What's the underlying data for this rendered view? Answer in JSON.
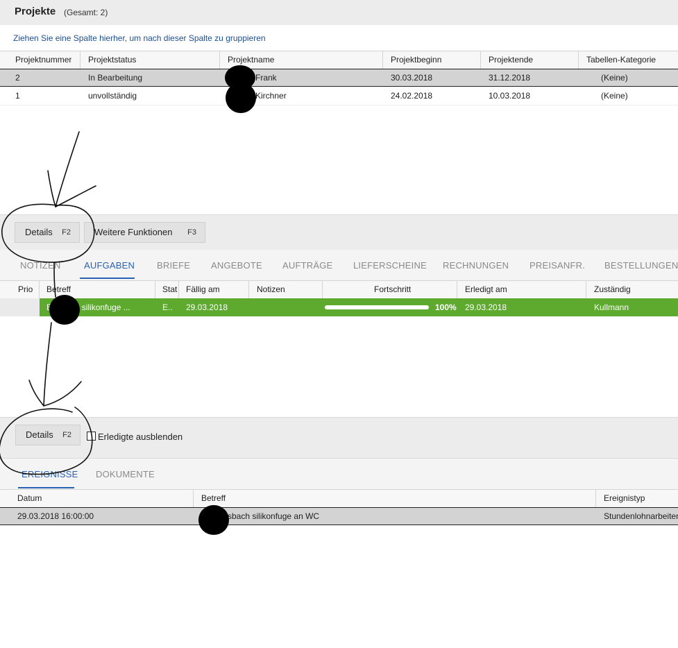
{
  "header": {
    "title": "Projekte",
    "total": "(Gesamt: 2)"
  },
  "group_hint": "Ziehen Sie eine Spalte hierher, um nach dieser Spalte zu gruppieren",
  "projects": {
    "columns": [
      "Projektnummer",
      "Projektstatus",
      "Projektname",
      "Projektbeginn",
      "Projektende",
      "Tabellen-Kategorie"
    ],
    "rows": [
      {
        "nummer": "2",
        "status": "In Bearbeitung",
        "name": "Frank",
        "beginn": "30.03.2018",
        "ende": "31.12.2018",
        "kategorie": "(Keine)"
      },
      {
        "nummer": "1",
        "status": "unvollständig",
        "name": "Kirchner",
        "beginn": "24.02.2018",
        "ende": "10.03.2018",
        "kategorie": "(Keine)"
      }
    ]
  },
  "toolbar1": {
    "details_label": "Details",
    "details_key": "F2",
    "more_label": "Weitere Funktionen",
    "more_key": "F3"
  },
  "tabs1": [
    "NOTIZEN",
    "AUFGABEN",
    "BRIEFE",
    "ANGEBOTE",
    "AUFTRÄGE",
    "LIEFERSCHEINE",
    "RECHNUNGEN",
    "PREISANFR.",
    "BESTELLUNGEN"
  ],
  "tasks": {
    "columns": [
      "Prio",
      "Betreff",
      "Stat",
      "Fällig am",
      "Notizen",
      "Fortschritt",
      "Erledigt am",
      "Zuständig"
    ],
    "rows": [
      {
        "prio": "",
        "betreff": "E... bach silikonfuge ...",
        "status": "E..",
        "faellig": "29.03.2018",
        "notizen": "",
        "progress": 1.0,
        "progress_label": "100%",
        "erledigt": "29.03.2018",
        "zustaendig": "Kullmann"
      }
    ]
  },
  "toolbar2": {
    "details_label": "Details",
    "details_key": "F2",
    "hide_done_label": "Erledigte ausblenden",
    "hide_done_checked": false
  },
  "tabs2": [
    "EREIGNISSE",
    "DOKUMENTE"
  ],
  "events": {
    "columns": [
      "Datum",
      "Betreff",
      "Ereignistyp"
    ],
    "rows": [
      {
        "datum": "29.03.2018 16:00:00",
        "betreff": "...sbach silikonfuge an WC",
        "typ": "Stundenlohnarbeiten"
      }
    ]
  },
  "colors": {
    "accent": "#2961b2",
    "row_done": "#5daa2f",
    "selected_row": "#d3d3d3"
  }
}
